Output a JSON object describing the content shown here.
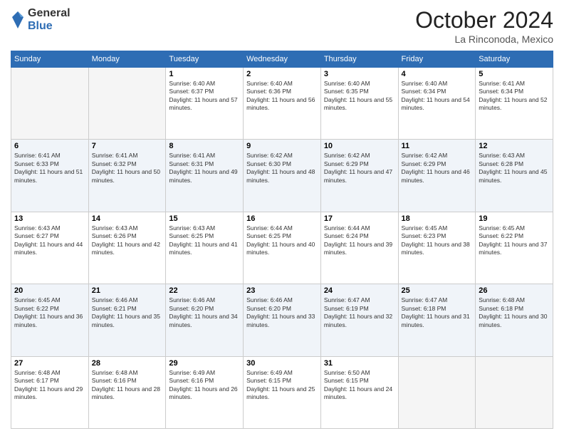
{
  "logo": {
    "general": "General",
    "blue": "Blue"
  },
  "header": {
    "month": "October 2024",
    "location": "La Rinconoda, Mexico"
  },
  "weekdays": [
    "Sunday",
    "Monday",
    "Tuesday",
    "Wednesday",
    "Thursday",
    "Friday",
    "Saturday"
  ],
  "weeks": [
    [
      null,
      null,
      {
        "day": 1,
        "sunrise": "6:40 AM",
        "sunset": "6:37 PM",
        "daylight": "11 hours and 57 minutes."
      },
      {
        "day": 2,
        "sunrise": "6:40 AM",
        "sunset": "6:36 PM",
        "daylight": "11 hours and 56 minutes."
      },
      {
        "day": 3,
        "sunrise": "6:40 AM",
        "sunset": "6:35 PM",
        "daylight": "11 hours and 55 minutes."
      },
      {
        "day": 4,
        "sunrise": "6:40 AM",
        "sunset": "6:34 PM",
        "daylight": "11 hours and 54 minutes."
      },
      {
        "day": 5,
        "sunrise": "6:41 AM",
        "sunset": "6:34 PM",
        "daylight": "11 hours and 52 minutes."
      }
    ],
    [
      {
        "day": 6,
        "sunrise": "6:41 AM",
        "sunset": "6:33 PM",
        "daylight": "11 hours and 51 minutes."
      },
      {
        "day": 7,
        "sunrise": "6:41 AM",
        "sunset": "6:32 PM",
        "daylight": "11 hours and 50 minutes."
      },
      {
        "day": 8,
        "sunrise": "6:41 AM",
        "sunset": "6:31 PM",
        "daylight": "11 hours and 49 minutes."
      },
      {
        "day": 9,
        "sunrise": "6:42 AM",
        "sunset": "6:30 PM",
        "daylight": "11 hours and 48 minutes."
      },
      {
        "day": 10,
        "sunrise": "6:42 AM",
        "sunset": "6:29 PM",
        "daylight": "11 hours and 47 minutes."
      },
      {
        "day": 11,
        "sunrise": "6:42 AM",
        "sunset": "6:29 PM",
        "daylight": "11 hours and 46 minutes."
      },
      {
        "day": 12,
        "sunrise": "6:43 AM",
        "sunset": "6:28 PM",
        "daylight": "11 hours and 45 minutes."
      }
    ],
    [
      {
        "day": 13,
        "sunrise": "6:43 AM",
        "sunset": "6:27 PM",
        "daylight": "11 hours and 44 minutes."
      },
      {
        "day": 14,
        "sunrise": "6:43 AM",
        "sunset": "6:26 PM",
        "daylight": "11 hours and 42 minutes."
      },
      {
        "day": 15,
        "sunrise": "6:43 AM",
        "sunset": "6:25 PM",
        "daylight": "11 hours and 41 minutes."
      },
      {
        "day": 16,
        "sunrise": "6:44 AM",
        "sunset": "6:25 PM",
        "daylight": "11 hours and 40 minutes."
      },
      {
        "day": 17,
        "sunrise": "6:44 AM",
        "sunset": "6:24 PM",
        "daylight": "11 hours and 39 minutes."
      },
      {
        "day": 18,
        "sunrise": "6:45 AM",
        "sunset": "6:23 PM",
        "daylight": "11 hours and 38 minutes."
      },
      {
        "day": 19,
        "sunrise": "6:45 AM",
        "sunset": "6:22 PM",
        "daylight": "11 hours and 37 minutes."
      }
    ],
    [
      {
        "day": 20,
        "sunrise": "6:45 AM",
        "sunset": "6:22 PM",
        "daylight": "11 hours and 36 minutes."
      },
      {
        "day": 21,
        "sunrise": "6:46 AM",
        "sunset": "6:21 PM",
        "daylight": "11 hours and 35 minutes."
      },
      {
        "day": 22,
        "sunrise": "6:46 AM",
        "sunset": "6:20 PM",
        "daylight": "11 hours and 34 minutes."
      },
      {
        "day": 23,
        "sunrise": "6:46 AM",
        "sunset": "6:20 PM",
        "daylight": "11 hours and 33 minutes."
      },
      {
        "day": 24,
        "sunrise": "6:47 AM",
        "sunset": "6:19 PM",
        "daylight": "11 hours and 32 minutes."
      },
      {
        "day": 25,
        "sunrise": "6:47 AM",
        "sunset": "6:18 PM",
        "daylight": "11 hours and 31 minutes."
      },
      {
        "day": 26,
        "sunrise": "6:48 AM",
        "sunset": "6:18 PM",
        "daylight": "11 hours and 30 minutes."
      }
    ],
    [
      {
        "day": 27,
        "sunrise": "6:48 AM",
        "sunset": "6:17 PM",
        "daylight": "11 hours and 29 minutes."
      },
      {
        "day": 28,
        "sunrise": "6:48 AM",
        "sunset": "6:16 PM",
        "daylight": "11 hours and 28 minutes."
      },
      {
        "day": 29,
        "sunrise": "6:49 AM",
        "sunset": "6:16 PM",
        "daylight": "11 hours and 26 minutes."
      },
      {
        "day": 30,
        "sunrise": "6:49 AM",
        "sunset": "6:15 PM",
        "daylight": "11 hours and 25 minutes."
      },
      {
        "day": 31,
        "sunrise": "6:50 AM",
        "sunset": "6:15 PM",
        "daylight": "11 hours and 24 minutes."
      },
      null,
      null
    ]
  ]
}
